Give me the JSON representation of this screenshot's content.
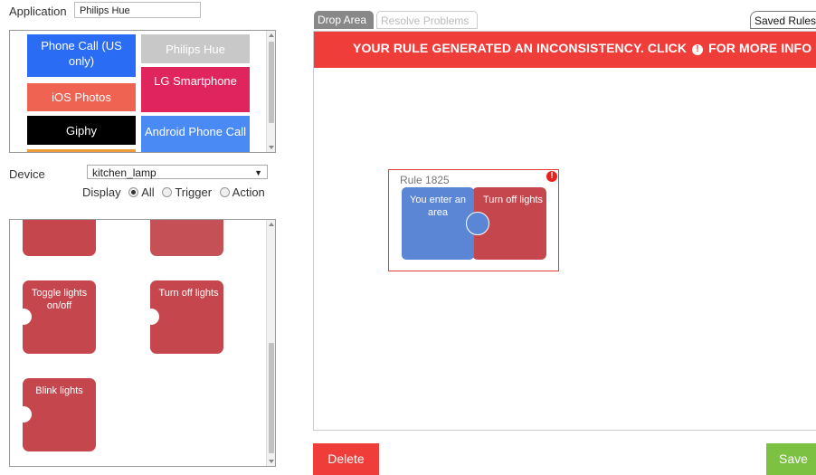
{
  "application": {
    "label": "Application",
    "value": "Philips Hue"
  },
  "app_list": {
    "tiles": [
      {
        "name": "Phone Call (US only)",
        "color": "#2a6df4"
      },
      {
        "name": "Philips Hue",
        "color": "#c8c8c8"
      },
      {
        "name": "iOS Photos",
        "color": "#ee6352"
      },
      {
        "name": "LG Smartphone",
        "color": "#e0245e"
      },
      {
        "name": "Giphy",
        "color": "#000000"
      },
      {
        "name": "Android Phone Call",
        "color": "#4a8af4"
      }
    ]
  },
  "device": {
    "label": "Device",
    "value": "kitchen_lamp"
  },
  "display": {
    "label": "Display",
    "options": [
      "All",
      "Trigger",
      "Action"
    ],
    "selected": "All"
  },
  "blocks": [
    {
      "label": ""
    },
    {
      "label": ""
    },
    {
      "label": "Toggle lights on/off"
    },
    {
      "label": "Turn off lights"
    },
    {
      "label": "Blink lights"
    }
  ],
  "tabs": {
    "drop_area": "Drop Area",
    "resolve_problems": "Resolve Problems",
    "saved_rules": "Saved Rules"
  },
  "banner": {
    "text_before": "YOUR RULE GENERATED AN INCONSISTENCY. CLICK",
    "icon": "!",
    "text_after": "FOR MORE INFO"
  },
  "rule": {
    "title": "Rule 1825",
    "alert": "!",
    "trigger": "You enter an area",
    "action": "Turn off lights"
  },
  "buttons": {
    "delete": "Delete",
    "save": "Save"
  },
  "colors": {
    "accent_red": "#ef3d3a",
    "block_red": "#c5474d",
    "trigger_blue": "#5b86d6",
    "save_green": "#7cc142"
  }
}
